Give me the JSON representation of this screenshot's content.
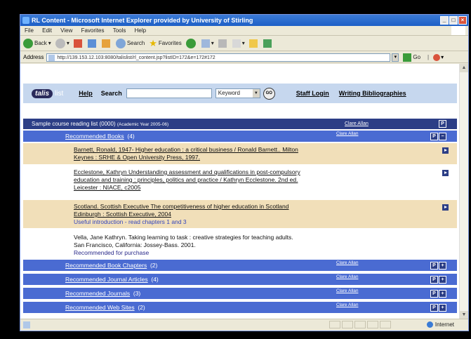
{
  "window": {
    "title": "RL Content - Microsoft Internet Explorer provided by University of Stirling"
  },
  "menu": [
    "File",
    "Edit",
    "View",
    "Favorites",
    "Tools",
    "Help"
  ],
  "toolbar": {
    "back": "Back",
    "search": "Search",
    "favorites": "Favorites"
  },
  "address": {
    "label": "Address",
    "url": "http://139.153.12.103:8080/talislist/rl_content.jsp?listID=172&e=172#172",
    "go": "Go"
  },
  "talis": {
    "logo": "talis",
    "logo_suffix": "list",
    "help": "Help",
    "search_label": "Search",
    "search_value": "",
    "search_type": "Keyword",
    "go": "GO",
    "staff_login": "Staff Login",
    "writing": "Writing Bibliographies"
  },
  "list": {
    "title": "Sample course reading list (0000)",
    "year": "(Academic Year 2005-06)",
    "owner": "Clare Allan",
    "p_button": "P"
  },
  "sections": [
    {
      "label": "Recommended Books",
      "count": "(4)",
      "owner": "Clare Allan"
    },
    {
      "label": "Recommended Book Chapters",
      "count": "(2)",
      "owner": "Clare Allan"
    },
    {
      "label": "Recommended Journal Articles",
      "count": "(4)",
      "owner": "Clare Allan"
    },
    {
      "label": "Recommended Journals",
      "count": "(3)",
      "owner": "Clare Allan"
    },
    {
      "label": "Recommended Web Sites",
      "count": "(2)",
      "owner": "Clare Allan"
    }
  ],
  "items": [
    {
      "line1": "Barnett, Ronald, 1947- Higher education : a critical business / Ronald Barnett.. Milton",
      "line2": "Keynes : SRHE & Open University Press, 1997."
    },
    {
      "line1": "Ecclestone, Kathryn Understanding assessment and qualifications in post-compulsory",
      "line2": "education and training : principles, politics and practice / Kathryn Ecclestone. 2nd ed.",
      "line3": "Leicester : NIACE, c2005"
    },
    {
      "line1": "Scotland. Scottish Executive The competitiveness of higher education in Scotland",
      "line2": "Edinburgh : Scottish Executive, 2004",
      "note": "Useful introduction - read chapters 1 and 3"
    },
    {
      "line1": "Vella, Jane Kathryn. Taking learning to task : creative strategies for teaching adults.",
      "line2": "San Francisco, California: Jossey-Bass. 2001.",
      "note": "Recommended for purchase"
    }
  ],
  "status": {
    "zone": "Internet"
  }
}
